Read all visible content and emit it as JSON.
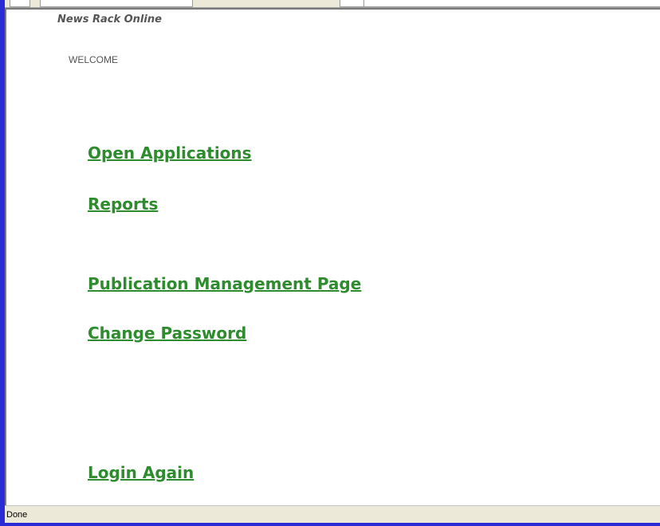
{
  "header": {
    "site_title": "News Rack Online",
    "welcome": "WELCOME"
  },
  "links": {
    "open_applications": "Open Applications",
    "reports": "Reports",
    "publication_management": "Publication Management Page",
    "change_password": "Change Password",
    "login_again": "Login Again"
  },
  "status_bar": {
    "text": "Done"
  },
  "colors": {
    "link": "#2e8b2e",
    "frame": "#2b2bd6",
    "chrome": "#ece9d8"
  }
}
